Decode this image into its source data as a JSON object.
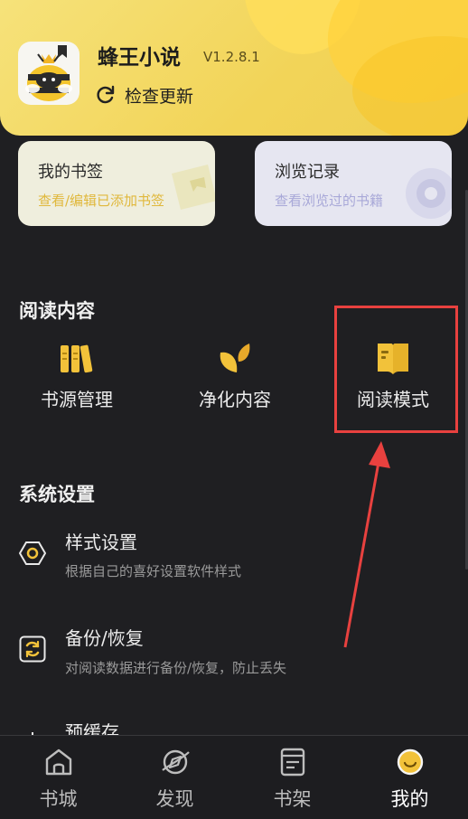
{
  "app": {
    "name": "蜂王小说",
    "version": "V1.2.8.1",
    "check_update": "检查更新"
  },
  "cards": {
    "bookmark": {
      "title": "我的书签",
      "subtitle": "查看/编辑已添加书签"
    },
    "history": {
      "title": "浏览记录",
      "subtitle": "查看浏览过的书籍"
    }
  },
  "reading": {
    "title": "阅读内容",
    "items": [
      {
        "label": "书源管理",
        "icon": "books-icon"
      },
      {
        "label": "净化内容",
        "icon": "leaf-icon"
      },
      {
        "label": "阅读模式",
        "icon": "open-book-icon"
      }
    ]
  },
  "settings": {
    "title": "系统设置",
    "items": [
      {
        "title": "样式设置",
        "desc": "根据自己的喜好设置软件样式",
        "icon": "hexagon-icon"
      },
      {
        "title": "备份/恢复",
        "desc": "对阅读数据进行备份/恢复，防止丢失",
        "icon": "sync-icon"
      },
      {
        "title": "预缓存",
        "icon": "download-icon"
      }
    ]
  },
  "nav": {
    "items": [
      {
        "label": "书城",
        "icon": "home-icon"
      },
      {
        "label": "发现",
        "icon": "compass-icon"
      },
      {
        "label": "书架",
        "icon": "bookshelf-icon"
      },
      {
        "label": "我的",
        "icon": "profile-icon",
        "active": true
      }
    ]
  },
  "colors": {
    "accent": "#f2c23a",
    "highlight": "#e8413f",
    "background": "#1f1f22",
    "header": "#f2d458"
  }
}
